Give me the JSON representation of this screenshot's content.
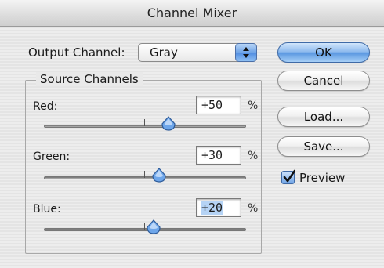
{
  "window": {
    "title": "Channel Mixer"
  },
  "output_channel": {
    "label": "Output Channel:",
    "selected": "Gray"
  },
  "source_channels": {
    "title": "Source Channels",
    "channels": [
      {
        "label": "Red:",
        "value": "+50",
        "unit": "%",
        "level_percent": 50
      },
      {
        "label": "Green:",
        "value": "+30",
        "unit": "%",
        "level_percent": 30
      },
      {
        "label": "Blue:",
        "value": "+20",
        "unit": "%",
        "level_percent": 20,
        "text_selected": true
      }
    ]
  },
  "buttons": {
    "ok": "OK",
    "cancel": "Cancel",
    "load": "Load...",
    "save": "Save..."
  },
  "preview": {
    "label": "Preview",
    "checked": true
  },
  "colors": {
    "accent_blue": "#5d99e2",
    "selection_highlight": "#b5d3f5",
    "background": "#ececec"
  },
  "icons": {
    "select_arrows": "updown-arrows-icon",
    "slider_thumb": "slider-thumb-icon",
    "preview_check": "checkmark-icon"
  }
}
